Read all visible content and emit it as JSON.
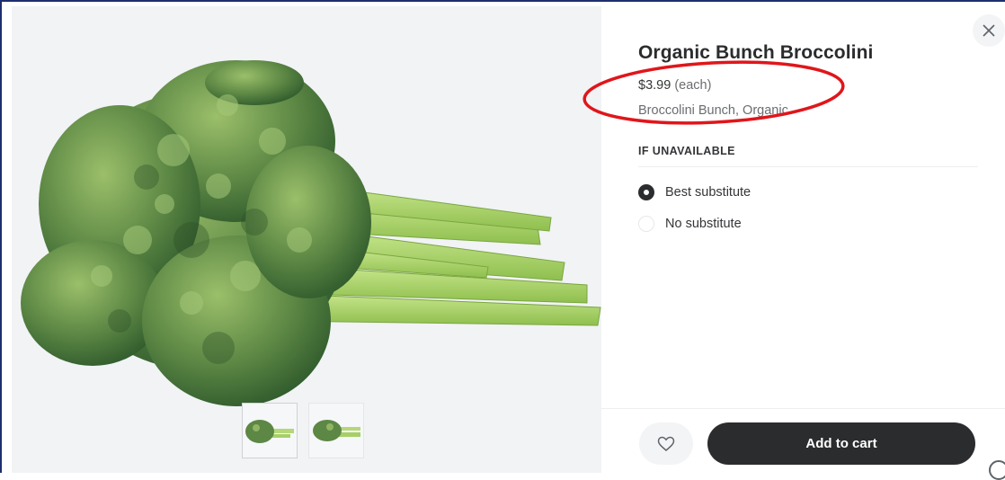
{
  "product": {
    "title": "Organic Bunch Broccolini",
    "price": "$3.99",
    "price_unit": "(each)",
    "variant": "Broccolini Bunch, Organic",
    "image_subject": "broccolini"
  },
  "gallery": {
    "thumbnails": [
      "broccolini-thumb-1",
      "broccolini-thumb-2"
    ],
    "active_index": 0
  },
  "unavailable": {
    "label": "IF UNAVAILABLE",
    "options": [
      {
        "label": "Best substitute",
        "selected": true
      },
      {
        "label": "No substitute",
        "selected": false
      }
    ]
  },
  "actions": {
    "add_to_cart": "Add to cart",
    "favorite_icon": "heart-outline-icon",
    "close_icon": "close-icon"
  },
  "colors": {
    "primary_button": "#2b2c2e",
    "annotation": "#e0161b",
    "frame_border": "#1d2f6e"
  }
}
